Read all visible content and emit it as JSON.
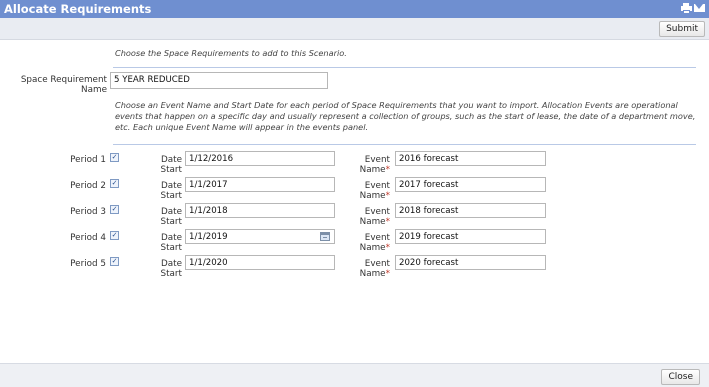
{
  "window": {
    "title": "Allocate Requirements"
  },
  "header_icons": [
    "printer-icon",
    "mail-icon"
  ],
  "toolbar": {
    "submit_label": "Submit"
  },
  "intro": {
    "text": "Choose the Space Requirements to add to this Scenario."
  },
  "space_requirement": {
    "label": "Space Requirement Name",
    "value": "5 YEAR REDUCED"
  },
  "periods_intro": {
    "text": "Choose an Event Name and Start Date for each period of Space Requirements that you want to import. Allocation Events are operational events that happen on a specific day and usually represent a collection of groups, such as the start of lease, the date of a department move, etc. Each unique Event Name will appear in the events panel."
  },
  "field_labels": {
    "date_start": "Date Start",
    "event_name": "Event Name",
    "required_marker": "*"
  },
  "periods": [
    {
      "label": "Period 1",
      "checked": true,
      "date_start": "1/12/2016",
      "event_name": "2016 forecast"
    },
    {
      "label": "Period 2",
      "checked": true,
      "date_start": "1/1/2017",
      "event_name": "2017 forecast"
    },
    {
      "label": "Period 3",
      "checked": true,
      "date_start": "1/1/2018",
      "event_name": "2018 forecast"
    },
    {
      "label": "Period 4",
      "checked": true,
      "date_start": "1/1/2019",
      "event_name": "2019 forecast"
    },
    {
      "label": "Period 5",
      "checked": true,
      "date_start": "1/1/2020",
      "event_name": "2020 forecast"
    }
  ],
  "footer": {
    "close_label": "Close"
  },
  "colors": {
    "title_bar": "#6f8fd0",
    "toolbar": "#e9ecf2",
    "separator": "#b9c9e6",
    "required": "#c0392b"
  }
}
